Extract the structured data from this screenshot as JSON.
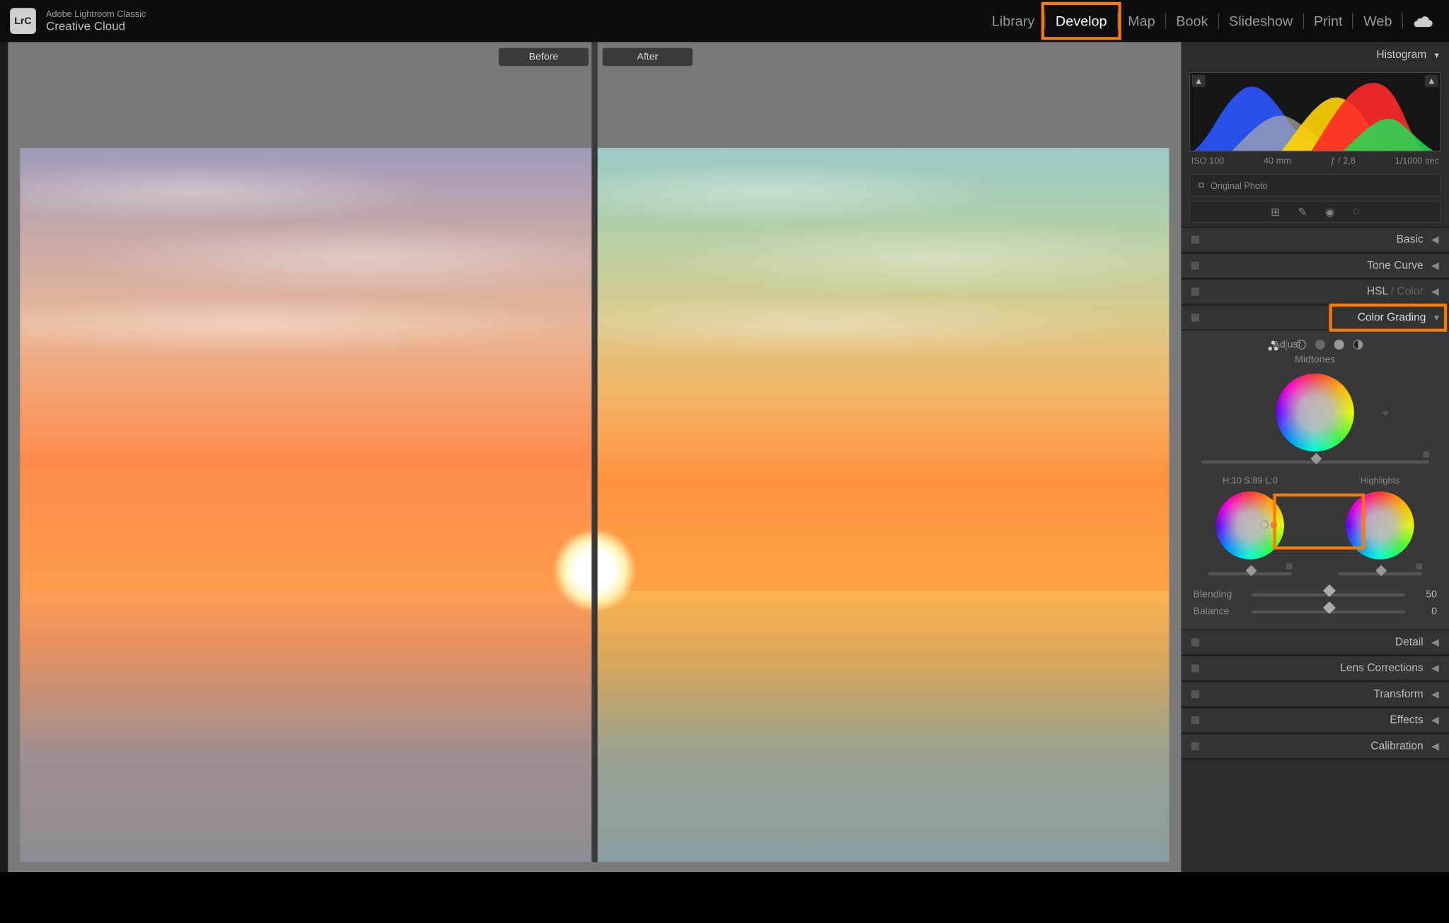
{
  "app": {
    "logo_short": "LrC",
    "subtitle": "Adobe Lightroom Classic",
    "title": "Creative Cloud"
  },
  "nav": {
    "items": [
      "Library",
      "Develop",
      "Map",
      "Book",
      "Slideshow",
      "Print",
      "Web"
    ],
    "active": "Develop"
  },
  "preview": {
    "before_label": "Before",
    "after_label": "After"
  },
  "histogram": {
    "header": "Histogram",
    "iso": "ISO 100",
    "focal": "40 mm",
    "aperture": "ƒ / 2,8",
    "shutter": "1/1000 sec",
    "original_label": "Original Photo"
  },
  "accordions": {
    "basic": "Basic",
    "tone_curve": "Tone Curve",
    "hsl": "HSL",
    "color": "Color",
    "color_grading": "Color Grading",
    "detail": "Detail",
    "lens": "Lens Corrections",
    "transform": "Transform",
    "effects": "Effects",
    "calibration": "Calibration"
  },
  "grading": {
    "adjust_label": "Adjust :",
    "midtones_label": "Midtones",
    "shadows_readout": "H:10 S:89 L:0",
    "highlights_label": "Highlights",
    "blending_label": "Blending",
    "blending_value": "50",
    "balance_label": "Balance",
    "balance_value": "0"
  },
  "highlights": {
    "develop_box": true,
    "color_grading_box": true,
    "shadows_highlights_box": true
  },
  "colors": {
    "highlight": "#ff7a00"
  }
}
